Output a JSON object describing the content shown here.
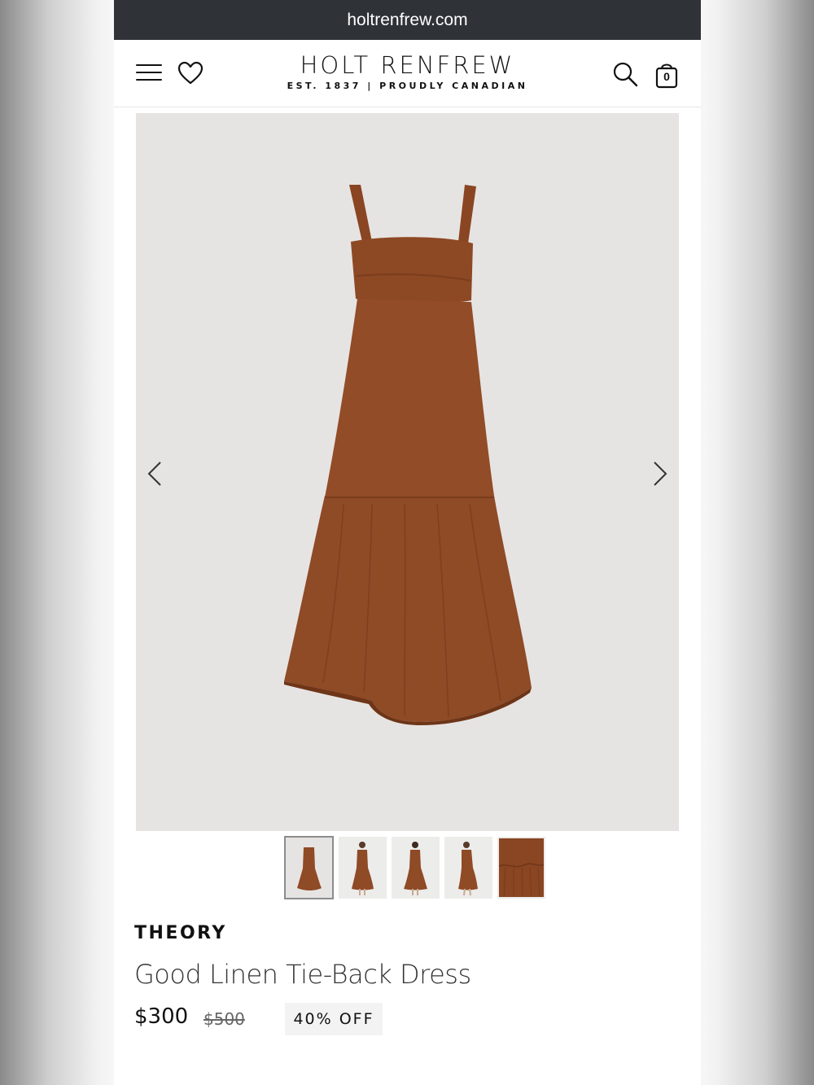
{
  "browser": {
    "url": "holtrenfrew.com"
  },
  "header": {
    "logo_title": "HOLT RENFREW",
    "logo_tagline": "EST. 1837 | PROUDLY CANADIAN",
    "bag_count": "0",
    "icons": [
      "menu-icon",
      "heart-icon",
      "search-icon",
      "shopping-bag-icon"
    ]
  },
  "gallery": {
    "nav_icons": [
      "chevron-left-icon",
      "chevron-right-icon"
    ],
    "thumbnail_count": 5,
    "active_thumbnail": 0
  },
  "product": {
    "brand": "THEORY",
    "name": "Good Linen Tie-Back Dress",
    "price": "$300",
    "original_price": "$500",
    "discount": "40% OFF"
  },
  "colors": {
    "dress": "#8f4a26",
    "image_background": "#e6e4e2",
    "url_bar": "#2f3337"
  }
}
